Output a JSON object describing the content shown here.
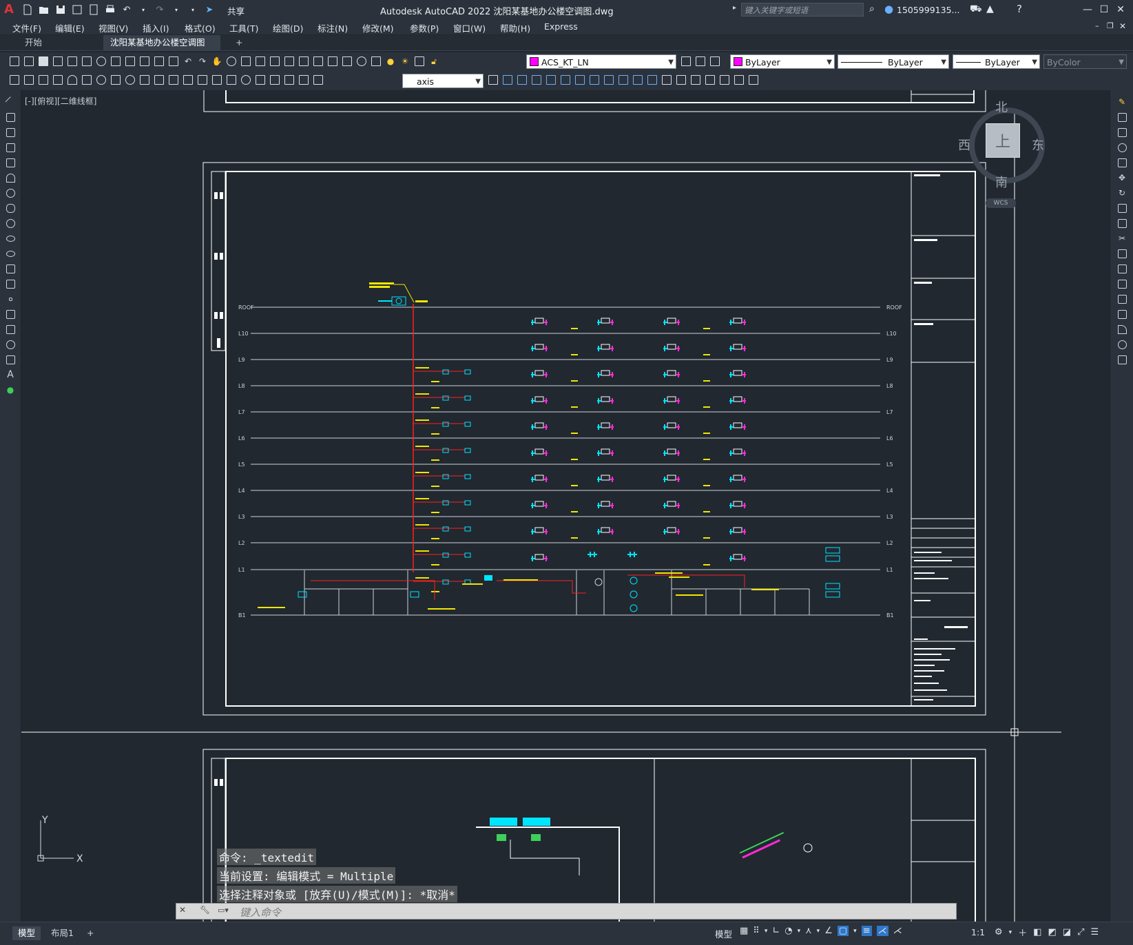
{
  "app": {
    "title": "Autodesk AutoCAD 2022    沈阳某基地办公楼空调图.dwg",
    "logo": "A",
    "share": "共享",
    "search_placeholder": "键入关键字或短语",
    "user": "1505999135..."
  },
  "menu": [
    "文件(F)",
    "编辑(E)",
    "视图(V)",
    "插入(I)",
    "格式(O)",
    "工具(T)",
    "绘图(D)",
    "标注(N)",
    "修改(M)",
    "参数(P)",
    "窗口(W)",
    "帮助(H)",
    "Express"
  ],
  "tabs": {
    "start": "开始",
    "active": "沈阳某基地办公楼空调图*",
    "add": "+"
  },
  "toolbar": {
    "layer": "ACS_KT_LN",
    "color": "ByLayer",
    "linetype": "ByLayer",
    "lineweight": "ByLayer",
    "plotstyle": "ByColor",
    "textstyle": "axis"
  },
  "viewport": {
    "label": "[-][俯视][二维线框]"
  },
  "viewcube": {
    "north": "北",
    "south": "南",
    "east": "东",
    "west": "西",
    "top": "上",
    "wcs": "WCS"
  },
  "ucs": {
    "x": "X",
    "y": "Y"
  },
  "drawing": {
    "levels_left": [
      "ROOF",
      "L10",
      "L9",
      "L8",
      "L7",
      "L6",
      "L5",
      "L4",
      "L3",
      "L2",
      "L1",
      "B1"
    ],
    "levels_right": [
      "ROOF",
      "L10",
      "L9",
      "L8",
      "L7",
      "L6",
      "L5",
      "L4",
      "L3",
      "L2",
      "L1",
      "B1"
    ]
  },
  "command": {
    "history": [
      "命令: _textedit",
      "当前设置: 编辑模式 = Multiple",
      "选择注释对象或 [放弃(U)/模式(M)]: *取消*"
    ],
    "prompt": "键入命令"
  },
  "status": {
    "model_tab": "模型",
    "layout_tab": "布局1",
    "add": "+",
    "model_label": "模型",
    "scale": "1:1"
  },
  "colors": {
    "accent_red": "#e0333c",
    "cyan": "#00e5ff",
    "magenta": "#ff2bd6",
    "yellow": "#f2e600",
    "riser_red": "#ff2020"
  }
}
